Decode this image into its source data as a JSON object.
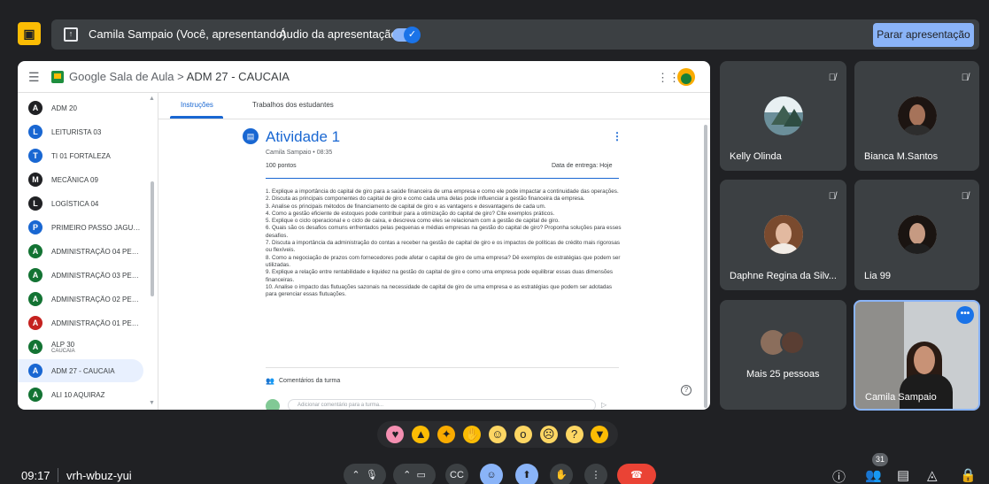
{
  "presenting_bar": {
    "presenter_text": "Camila Sampaio (Você, apresentando)",
    "audio_label": "Áudio da apresentação",
    "audio_enabled": true,
    "stop_label": "Parar apresentação"
  },
  "classroom": {
    "app_name": "Google Sala de Aula",
    "separator": ">",
    "class_name": "ADM 27 - CAUCAIA",
    "sidebar": [
      {
        "initial": "A",
        "label": "ADM 20",
        "color": "#202124"
      },
      {
        "initial": "L",
        "label": "LEITURISTA 03",
        "color": "#1967d2"
      },
      {
        "initial": "T",
        "label": "TI 01 FORTALEZA",
        "color": "#1967d2"
      },
      {
        "initial": "M",
        "label": "MECÂNICA 09",
        "color": "#202124"
      },
      {
        "initial": "L",
        "label": "LOGÍSTICA 04",
        "color": "#202124"
      },
      {
        "initial": "P",
        "label": "PRIMEIRO PASSO JAGUARI...",
        "color": "#1967d2"
      },
      {
        "initial": "A",
        "label": "ADMINISTRAÇÃO 04 PEREI...",
        "color": "#137333"
      },
      {
        "initial": "A",
        "label": "ADMINISTRAÇÃO 03 PEREI...",
        "color": "#137333"
      },
      {
        "initial": "A",
        "label": "ADMINISTRAÇÃO 02 PEREI...",
        "color": "#137333"
      },
      {
        "initial": "A",
        "label": "ADMINISTRAÇÃO 01 PEREI...",
        "color": "#c5221f"
      },
      {
        "initial": "A",
        "label": "ALP 30",
        "sub": "CAUCAIA",
        "color": "#137333"
      },
      {
        "initial": "A",
        "label": "ADM 27 - CAUCAIA",
        "color": "#1967d2",
        "active": true
      },
      {
        "initial": "A",
        "label": "ALI 10 AQUIRAZ",
        "color": "#137333"
      }
    ],
    "tabs": [
      "Instruções",
      "Trabalhos dos estudantes"
    ],
    "activity": {
      "icon": "assignment-icon",
      "title": "Atividade 1",
      "author": "Camila Sampaio • 08:35",
      "points": "100 pontos",
      "due": "Data de entrega: Hoje",
      "questions": [
        "1. Explique a importância do capital de giro para a saúde financeira de uma empresa e como ele pode impactar a continuidade das operações.",
        "2. Discuta as principais componentes do capital de giro e como cada uma delas pode influenciar a gestão financeira da empresa.",
        "3. Analise os principais métodos de financiamento de capital de giro e as vantagens e desvantagens de cada um.",
        "4. Como a gestão eficiente de estoques pode contribuir para a otimização do capital de giro? Cite exemplos práticos.",
        "5. Explique o ciclo operacional e o ciclo de caixa, e descreva como eles se relacionam com a gestão de capital de giro.",
        "6. Quais são os desafios comuns enfrentados pelas pequenas e médias empresas na gestão do capital de giro? Proponha soluções para esses desafios.",
        "7. Discuta a importância da administração do contas a receber na gestão de capital de giro e os impactos de políticas de crédito mais rigorosas ou flexíveis.",
        "8. Como a negociação de prazos com fornecedores pode afetar o capital de giro de uma empresa? Dê exemplos de estratégias que podem ser utilizadas.",
        "9. Explique a relação entre rentabilidade e liquidez na gestão do capital de giro e como uma empresa pode equilibrar essas duas dimensões financeiras.",
        "10. Analise o impacto das flutuações sazonais na necessidade de capital de giro de uma empresa e as estratégias que podem ser adotadas para gerenciar essas flutuações."
      ],
      "comments_label": "Comentários da turma",
      "comment_placeholder": "Adicionar comentário para a turma..."
    }
  },
  "participants": [
    {
      "name": "Kelly Olinda",
      "muted": true
    },
    {
      "name": "Bianca M.Santos",
      "muted": true
    },
    {
      "name": "Daphne Regina da Silv...",
      "muted": true
    },
    {
      "name": "Lia 99",
      "muted": true
    },
    {
      "name": "Mais 25 pessoas"
    },
    {
      "name": "Camila Sampaio",
      "speaking": true
    }
  ],
  "reactions": [
    "sparkling-heart",
    "thumbs-up",
    "party-popper",
    "clapping-hands",
    "laughing-face",
    "surprised-face",
    "crying-face",
    "thinking-face",
    "thumbs-down"
  ],
  "bottom_bar": {
    "time": "09:17",
    "separator": "|",
    "meeting_code": "vrh-wbuz-yui",
    "participant_count": "31"
  }
}
